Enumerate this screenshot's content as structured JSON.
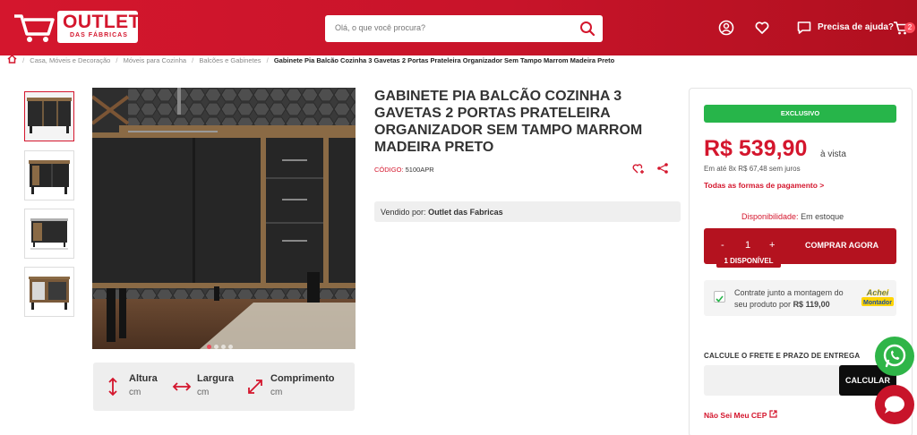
{
  "header": {
    "logo_main": "OUTLET",
    "logo_sub": "DAS FÁBRICAS",
    "search_placeholder": "Olá, o que você procura?",
    "help_label": "Precisa de ajuda?",
    "cart_count": "2"
  },
  "breadcrumb": {
    "items": [
      "Casa, Móveis e Decoração",
      "Móveis para Cozinha",
      "Balcões e Gabinetes"
    ],
    "current": "Gabinete Pia Balcão Cozinha 3 Gavetas 2 Portas Prateleira Organizador Sem Tampo Marrom Madeira Preto",
    "separator": "/"
  },
  "product": {
    "title": "GABINETE PIA BALCÃO COZINHA 3 GAVETAS 2 PORTAS PRATELEIRA ORGANIZADOR SEM TAMPO MARROM MADEIRA PRETO",
    "code_label": "CÓDIGO:",
    "code_value": "5100APR",
    "seller_label": "Vendido por:",
    "seller_name": "Outlet das Fabricas"
  },
  "dimensions": [
    {
      "label": "Altura",
      "unit": "cm",
      "icon": "vertical-arrows-icon"
    },
    {
      "label": "Largura",
      "unit": "cm",
      "icon": "horizontal-arrows-icon"
    },
    {
      "label": "Comprimento",
      "unit": "cm",
      "icon": "diagonal-arrows-icon"
    }
  ],
  "purchase": {
    "badge": "EXCLUSIVO",
    "price": "R$ 539,90",
    "price_suffix": "à vista",
    "installments": "Em até 8x R$ 67,48 sem juros",
    "payments_link": "Todas as formas de pagamento >",
    "availability_label": "Disponibilidade:",
    "availability_value": "Em estoque",
    "qty_minus": "-",
    "qty_value": "1",
    "qty_plus": "+",
    "buy_label": "COMPRAR AGORA",
    "available_badge": "1 DISPONÍVEL",
    "mount_text_1": "Contrate junto a montagem do",
    "mount_text_2": "seu produto por",
    "mount_price": "R$ 119,00",
    "mount_logo_1": "Achei",
    "mount_logo_2": "Montador",
    "freight_label": "CALCULE O FRETE E PRAZO DE ENTREGA",
    "calc_label": "CALCULAR",
    "cep_link": "Não Sei Meu CEP"
  },
  "colors": {
    "brand_red": "#d4162d",
    "dark_red": "#b4121f",
    "green": "#27b54a",
    "whatsapp": "#2fb548"
  },
  "gallery": {
    "thumb_count": 4,
    "active_thumb": 1,
    "dot_count": 4,
    "active_dot": 1
  }
}
